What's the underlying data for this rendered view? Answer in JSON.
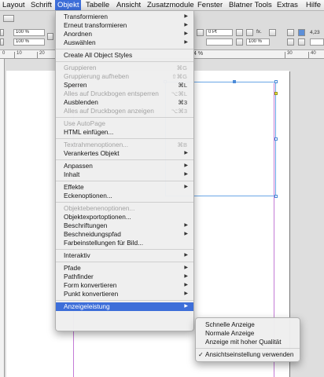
{
  "menubar": {
    "items": [
      "Layout",
      "Schrift",
      "Objekt",
      "Tabelle",
      "Ansicht",
      "Zusatzmodule",
      "Fenster",
      "Blatner Tools",
      "Extras",
      "Hilfe"
    ],
    "active": "Objekt"
  },
  "control_panel": {
    "field_1": "100 %",
    "field_2": "100 %",
    "field_3": "0 Pt",
    "field_4": "100 %",
    "value_right": "4,23",
    "label_fx": "fx."
  },
  "ruler": {
    "labels": [
      "0",
      "10",
      "20",
      "30",
      "40"
    ]
  },
  "document": {
    "zoom_fragment": "4 %"
  },
  "objekt_menu": {
    "items": [
      {
        "label": "Transformieren",
        "submenu": true
      },
      {
        "label": "Erneut transformieren",
        "submenu": true
      },
      {
        "label": "Anordnen",
        "submenu": true
      },
      {
        "label": "Auswählen",
        "submenu": true
      },
      {
        "separator": true
      },
      {
        "label": "Create All Object Styles"
      },
      {
        "separator": true
      },
      {
        "label": "Gruppieren",
        "shortcut": "⌘G",
        "disabled": true
      },
      {
        "label": "Gruppierung aufheben",
        "shortcut": "⇧⌘G",
        "disabled": true
      },
      {
        "label": "Sperren",
        "shortcut": "⌘L"
      },
      {
        "label": "Alles auf Druckbogen entsperren",
        "shortcut": "⌥⌘L",
        "disabled": true
      },
      {
        "label": "Ausblenden",
        "shortcut": "⌘3"
      },
      {
        "label": "Alles auf Druckbogen anzeigen",
        "shortcut": "⌥⌘3",
        "disabled": true
      },
      {
        "separator": true
      },
      {
        "label": "Use AutoPage",
        "disabled": true
      },
      {
        "label": "HTML einfügen..."
      },
      {
        "separator": true
      },
      {
        "label": "Textrahmenoptionen...",
        "shortcut": "⌘B",
        "disabled": true
      },
      {
        "label": "Verankertes Objekt",
        "submenu": true
      },
      {
        "separator": true
      },
      {
        "label": "Anpassen",
        "submenu": true
      },
      {
        "label": "Inhalt",
        "submenu": true
      },
      {
        "separator": true
      },
      {
        "label": "Effekte",
        "submenu": true
      },
      {
        "label": "Eckenoptionen..."
      },
      {
        "separator": true
      },
      {
        "label": "Objektebenenoptionen...",
        "disabled": true
      },
      {
        "label": "Objektexportoptionen..."
      },
      {
        "label": "Beschriftungen",
        "submenu": true
      },
      {
        "label": "Beschneidungspfad",
        "submenu": true
      },
      {
        "label": "Farbeinstellungen für Bild..."
      },
      {
        "separator": true
      },
      {
        "label": "Interaktiv",
        "submenu": true
      },
      {
        "separator": true
      },
      {
        "label": "Pfade",
        "submenu": true
      },
      {
        "label": "Pathfinder",
        "submenu": true
      },
      {
        "label": "Form konvertieren",
        "submenu": true
      },
      {
        "label": "Punkt konvertieren",
        "submenu": true
      },
      {
        "separator": true
      },
      {
        "label": "Anzeigeleistung",
        "submenu": true,
        "highlighted": true
      }
    ]
  },
  "anzeige_submenu": {
    "items": [
      {
        "label": "Schnelle Anzeige"
      },
      {
        "label": "Normale Anzeige"
      },
      {
        "label": "Anzeige mit hoher Qualität"
      },
      {
        "separator": true
      },
      {
        "label": "Ansichtseinstellung verwenden",
        "checked": true
      }
    ],
    "check_glyph": "✓"
  },
  "icons": {
    "submenu_arrow": "▶",
    "highlight_color": "#3d6ed9"
  }
}
